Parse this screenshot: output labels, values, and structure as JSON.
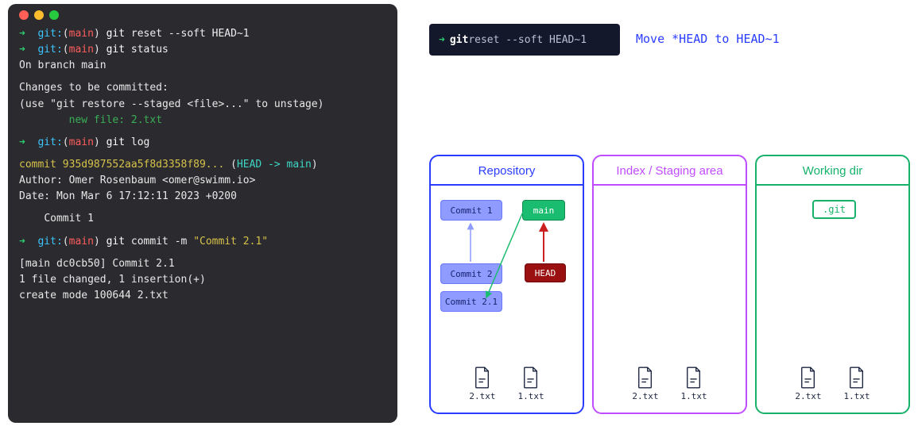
{
  "terminal": {
    "lines": [
      {
        "prompt": true,
        "command": "reset --soft HEAD~1"
      },
      {
        "prompt": true,
        "command": "status"
      },
      {
        "text": "On branch main"
      },
      {
        "text": "Changes to be committed:"
      },
      {
        "text": "  (use \"git restore --staged <file>...\" to unstage)"
      }
    ],
    "newfile_label": "new file:   2.txt",
    "log_cmd": "log",
    "commit_hash": "commit 935d987552aa5f8d3358f89...",
    "head_ref": "HEAD -> main",
    "author": "Author: Omer Rosenbaum <omer@swimm.io>",
    "date": "Date:   Mon Mar 6 17:12:11 2023 +0200",
    "commit_msg1": "Commit 1",
    "commit_cmd": "commit -m",
    "commit_str": "\"Commit 2.1\"",
    "result1": "[main dc0cb50] Commit 2.1",
    "result2": " 1 file changed, 1 insertion(+)",
    "result3": " create mode 100644 2.txt",
    "git_prefix": "git:",
    "branch": "main",
    "git_word": "git"
  },
  "miniterm": {
    "git": "git",
    "rest": " reset --soft HEAD~1"
  },
  "annotation": "Move *HEAD to HEAD~1",
  "panels": {
    "repo": {
      "title": "Repository",
      "commits": [
        "Commit 1",
        "Commit 2",
        "Commit 2.1"
      ],
      "main": "main",
      "head": "HEAD",
      "files": [
        "2.txt",
        "1.txt"
      ]
    },
    "index": {
      "title": "Index / Staging area",
      "files": [
        "2.txt",
        "1.txt"
      ]
    },
    "wdir": {
      "title": "Working dir",
      "gitdir": ".git",
      "files": [
        "2.txt",
        "1.txt"
      ]
    }
  }
}
